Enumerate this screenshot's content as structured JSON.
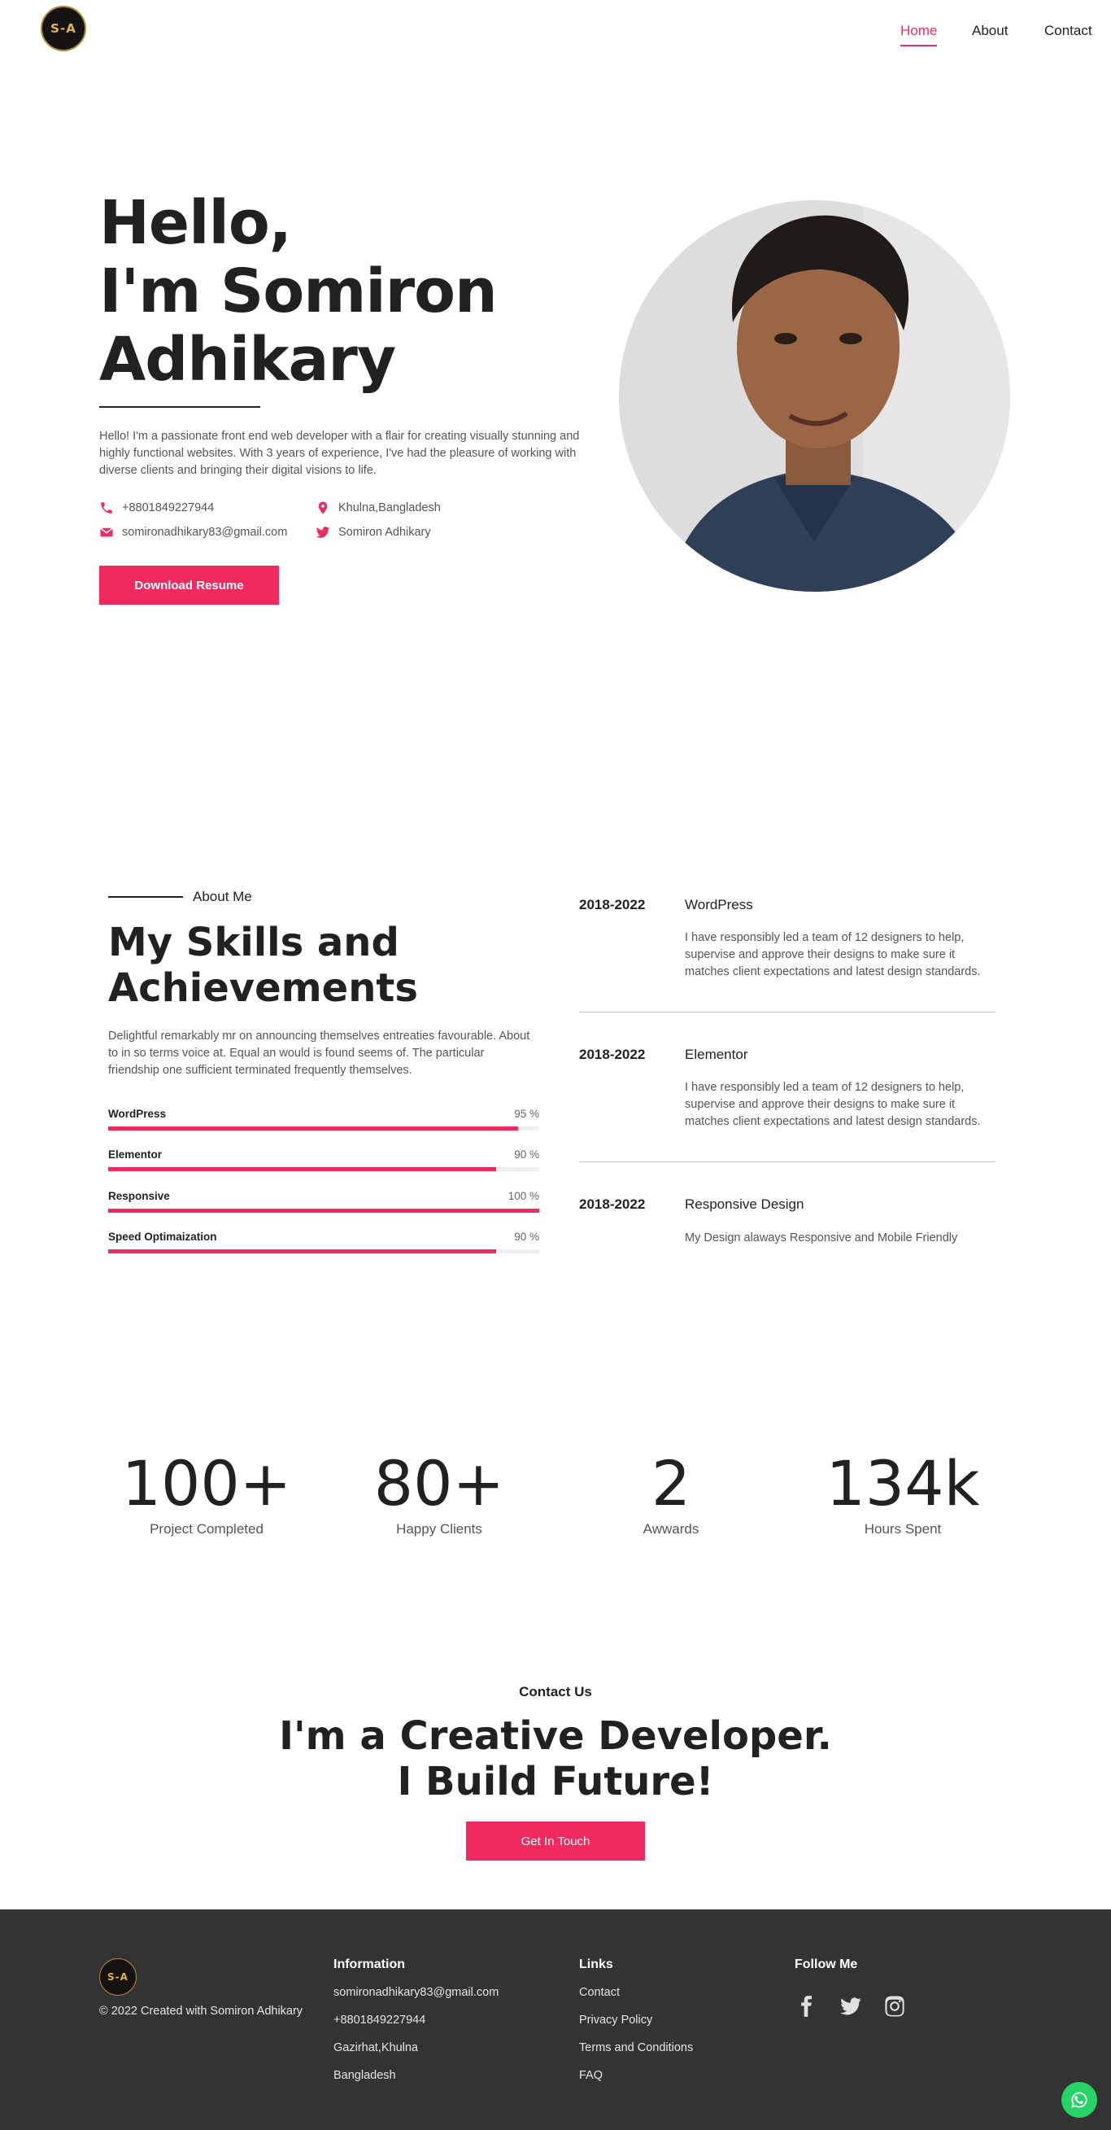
{
  "header": {
    "logo_text": "S-A",
    "nav": [
      {
        "label": "Home",
        "active": true
      },
      {
        "label": "About",
        "active": false
      },
      {
        "label": "Contact",
        "active": false
      }
    ]
  },
  "hero": {
    "greeting": "Hello,",
    "name_line1": "I'm Somiron",
    "name_line2": "Adhikary",
    "description": "Hello! I'm a passionate front end web developer with a flair for creating visually stunning and highly functional websites. With 3 years of experience, I've had the pleasure of working with diverse clients and bringing their digital visions to life.",
    "phone": "+8801849227944",
    "email": "somironadhikary83@gmail.com",
    "location": "Khulna,Bangladesh",
    "twitter": "Somiron Adhikary",
    "download_label": "Download Resume"
  },
  "skills": {
    "eyebrow": "About Me",
    "title_line1": "My Skills and",
    "title_line2": "Achievements",
    "description": "Delightful remarkably mr on announcing themselves entreaties favourable. About to in so terms voice at. Equal an would is found seems of. The particular friendship one sufficient terminated frequently themselves.",
    "items": [
      {
        "name": "WordPress",
        "percent": 95,
        "label": "95 %"
      },
      {
        "name": "Elementor",
        "percent": 90,
        "label": "90 %"
      },
      {
        "name": "Responsive",
        "percent": 100,
        "label": "100 %"
      },
      {
        "name": "Speed Optimaization",
        "percent": 90,
        "label": "90 %"
      }
    ]
  },
  "timeline": [
    {
      "year": "2018-2022",
      "title": "WordPress",
      "desc": "I have responsibly led a team of 12 designers to help, supervise and approve their designs to make sure it matches client expectations and latest design standards."
    },
    {
      "year": "2018-2022",
      "title": "Elementor",
      "desc": "I have responsibly led a team of 12 designers to help, supervise and approve their designs to make sure it matches client expectations and latest design standards."
    },
    {
      "year": "2018-2022",
      "title": "Responsive Design",
      "desc": "My Design alaways Responsive and Mobile Friendly"
    }
  ],
  "stats": [
    {
      "value": "100+",
      "label": "Project Completed"
    },
    {
      "value": "80+",
      "label": "Happy Clients"
    },
    {
      "value": "2",
      "label": "Awwards"
    },
    {
      "value": "134k",
      "label": "Hours Spent"
    }
  ],
  "contact": {
    "eyebrow": "Contact Us",
    "line1": "I'm a Creative Developer.",
    "line2": "I Build Future!",
    "button_label": "Get In Touch"
  },
  "footer": {
    "copyright": "© 2022 Created with Somiron Adhikary",
    "info_head": "Information",
    "info": [
      "somironadhikary83@gmail.com",
      "+8801849227944",
      "Gazirhat,Khulna",
      "Bangladesh"
    ],
    "links_head": "Links",
    "links": [
      "Contact",
      "Privacy Policy",
      "Terms and Conditions",
      "FAQ"
    ],
    "follow_head": "Follow Me",
    "social_icons": [
      "facebook-icon",
      "twitter-icon",
      "instagram-icon"
    ]
  },
  "colors": {
    "accent": "#f02a5f",
    "footer_bg": "#333333",
    "whatsapp": "#27d266"
  }
}
